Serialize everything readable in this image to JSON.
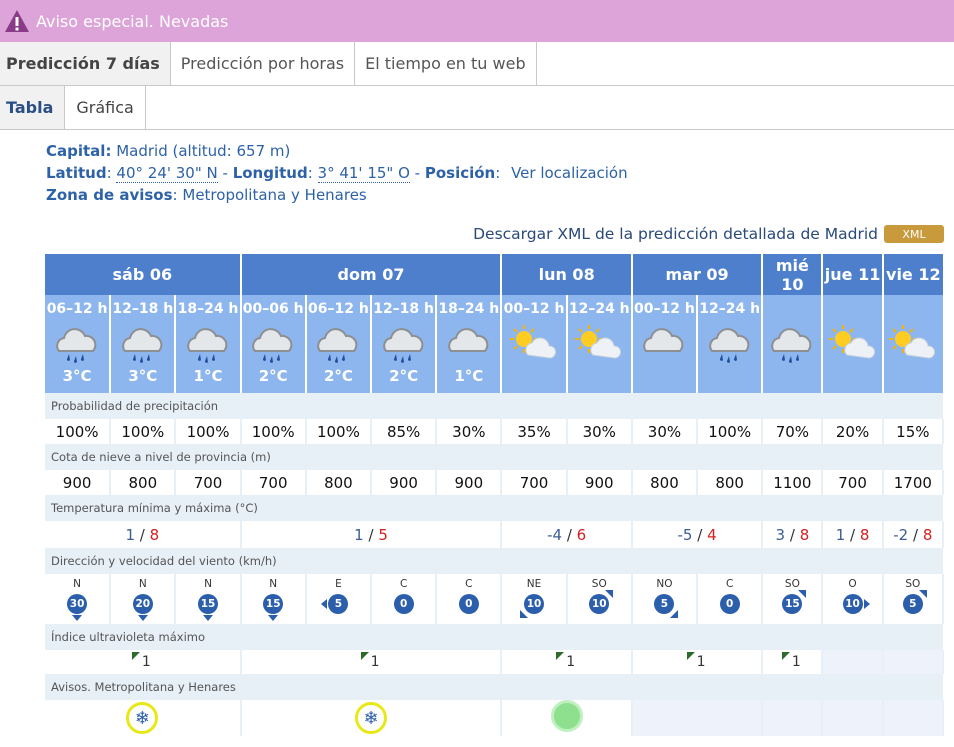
{
  "alert": {
    "text": "Aviso especial. Nevadas",
    "icon": "warning-icon",
    "bg": "#dca4d8"
  },
  "tabs_main": [
    {
      "label": "Predicción 7 días",
      "active": true
    },
    {
      "label": "Predicción por horas",
      "active": false
    },
    {
      "label": "El tiempo en tu web",
      "active": false
    }
  ],
  "tabs_view": [
    {
      "label": "Tabla",
      "active": true
    },
    {
      "label": "Gráfica",
      "active": false
    }
  ],
  "info": {
    "capital_label": "Capital:",
    "capital_value": "Madrid (altitud: 657 m)",
    "latitud_label": "Latitud",
    "latitud_value": "40° 24' 30\" N",
    "longitud_label": "Longitud",
    "longitud_value": "3° 41' 15\" O",
    "posicion_label": "Posición",
    "posicion_link": "Ver localización",
    "zona_label": "Zona de avisos",
    "zona_value": "Metropolitana y Henares"
  },
  "xml": {
    "text": "Descargar XML de la predicción detallada de Madrid",
    "badge": "XML"
  },
  "days": [
    "sáb 06",
    "dom 07",
    "lun 08",
    "mar 09",
    "mié 10",
    "jue 11",
    "vie 12"
  ],
  "periods": [
    {
      "label": "06–12 h",
      "icon": "rain-cloud-icon",
      "temp": "3°C"
    },
    {
      "label": "12–18 h",
      "icon": "rain-cloud-icon",
      "temp": "3°C"
    },
    {
      "label": "18–24 h",
      "icon": "rain-cloud-icon",
      "temp": "1°C"
    },
    {
      "label": "00–06 h",
      "icon": "rain-cloud-icon",
      "temp": "2°C"
    },
    {
      "label": "06–12 h",
      "icon": "rain-cloud-icon",
      "temp": "2°C"
    },
    {
      "label": "12–18 h",
      "icon": "rain-cloud-icon",
      "temp": "2°C"
    },
    {
      "label": "18–24 h",
      "icon": "cloud-icon",
      "temp": "1°C"
    },
    {
      "label": "00–12 h",
      "icon": "sun-cloud-icon",
      "temp": ""
    },
    {
      "label": "12–24 h",
      "icon": "sun-cloud-icon",
      "temp": ""
    },
    {
      "label": "00–12 h",
      "icon": "cloud-icon",
      "temp": ""
    },
    {
      "label": "12–24 h",
      "icon": "rain-cloud-icon",
      "temp": ""
    },
    {
      "label": "",
      "icon": "rain-cloud-icon",
      "temp": ""
    },
    {
      "label": "",
      "icon": "sun-cloud-icon",
      "temp": ""
    },
    {
      "label": "",
      "icon": "sun-cloud-icon",
      "temp": ""
    }
  ],
  "sections": {
    "precip": "Probabilidad de precipitación",
    "nieve": "Cota de nieve a nivel de provincia (m)",
    "temp": "Temperatura mínima y máxima (°C)",
    "viento": "Dirección y velocidad del viento (km/h)",
    "uv": "Índice ultravioleta máximo",
    "avisos": "Avisos. Metropolitana y Henares"
  },
  "precip": [
    "100%",
    "100%",
    "100%",
    "100%",
    "100%",
    "85%",
    "30%",
    "35%",
    "30%",
    "30%",
    "100%",
    "70%",
    "20%",
    "15%"
  ],
  "nieve": [
    "900",
    "800",
    "700",
    "700",
    "800",
    "900",
    "900",
    "700",
    "900",
    "800",
    "800",
    "1100",
    "700",
    "1700"
  ],
  "temps": [
    {
      "min": "1",
      "max": "8"
    },
    {
      "min": "1",
      "max": "5"
    },
    {
      "min": "-4",
      "max": "6"
    },
    {
      "min": "-5",
      "max": "4"
    },
    {
      "min": "3",
      "max": "8"
    },
    {
      "min": "1",
      "max": "8"
    },
    {
      "min": "-2",
      "max": "8"
    }
  ],
  "temp_sep": "/",
  "wind": [
    {
      "dir": "N",
      "speed": "30"
    },
    {
      "dir": "N",
      "speed": "20"
    },
    {
      "dir": "N",
      "speed": "15"
    },
    {
      "dir": "N",
      "speed": "15"
    },
    {
      "dir": "E",
      "speed": "5"
    },
    {
      "dir": "C",
      "speed": "0"
    },
    {
      "dir": "C",
      "speed": "0"
    },
    {
      "dir": "NE",
      "speed": "10"
    },
    {
      "dir": "SO",
      "speed": "10"
    },
    {
      "dir": "NO",
      "speed": "5"
    },
    {
      "dir": "C",
      "speed": "0"
    },
    {
      "dir": "SO",
      "speed": "15"
    },
    {
      "dir": "O",
      "speed": "10"
    },
    {
      "dir": "SO",
      "speed": "5"
    }
  ],
  "uv": [
    "1",
    "1",
    "1",
    "1",
    "1"
  ],
  "avisos": [
    {
      "type": "snow-icon"
    },
    {
      "type": "snow-icon"
    },
    {
      "type": "green-circle-icon"
    }
  ]
}
